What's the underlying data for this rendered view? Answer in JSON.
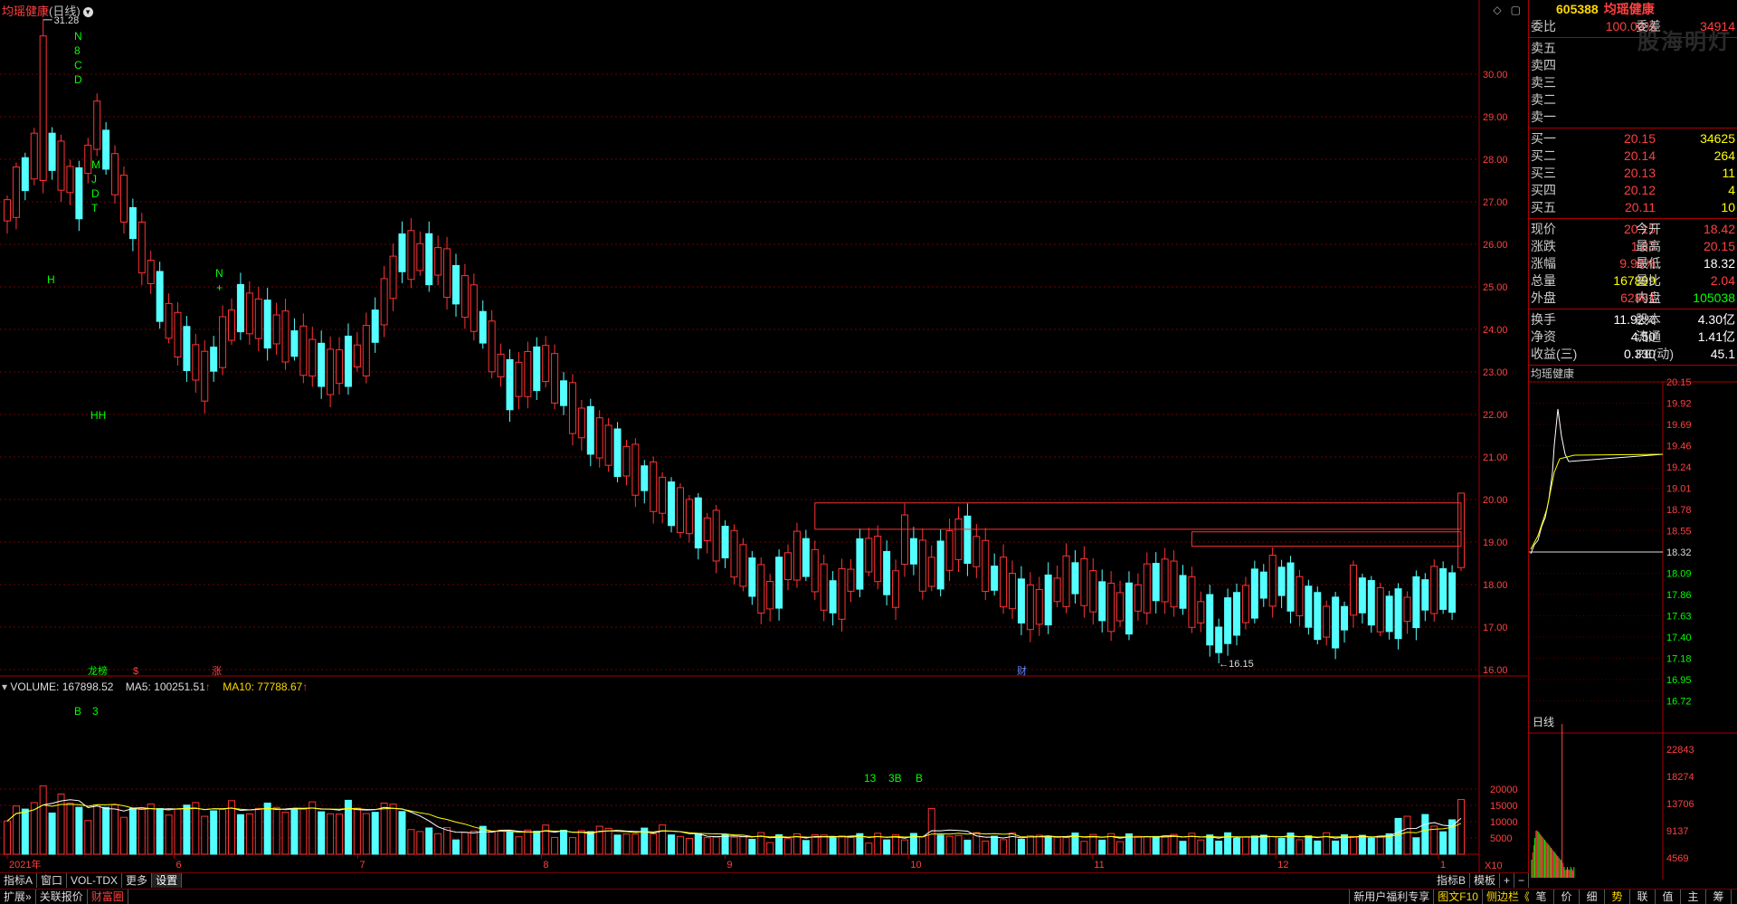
{
  "kline": {
    "name": "均瑶健康",
    "period": "(日线)",
    "high_mark": "31.28",
    "low_mark": "16.15",
    "signals": {
      "n8cd": [
        "N",
        "8",
        "C",
        "D"
      ],
      "mjdt": [
        "M",
        "J",
        "D",
        "T"
      ],
      "h": "H",
      "hh": "HH",
      "n": "N",
      "plus": "+"
    },
    "event_tags": {
      "longhu": "龙榜",
      "dollar": "$",
      "zhang": "涨",
      "cai": "财"
    },
    "price_axis": [
      "30.00",
      "29.00",
      "28.00",
      "27.00",
      "26.00",
      "25.00",
      "24.00",
      "23.00",
      "22.00",
      "21.00",
      "20.00",
      "19.00",
      "18.00",
      "17.00",
      "16.00"
    ],
    "colors": {
      "up": "#ff3232",
      "down": "#54ffff",
      "grid": "#700000",
      "ma5": "#ffffff",
      "ma10": "#ffff00",
      "box": "#ff3232"
    }
  },
  "volume": {
    "title": "VOLUME: 167898.52",
    "ma5": "MA5: 100251.51",
    "ma10": "MA10: 77788.67",
    "axis": [
      "20000",
      "15000",
      "10000",
      "5000"
    ],
    "x10": "X10",
    "signals": {
      "b3": "3",
      "b": "B",
      "s13": "13",
      "s3b": "3B",
      "sb": "B"
    }
  },
  "time_axis": [
    "2021年",
    "6",
    "7",
    "8",
    "9",
    "10",
    "11",
    "12",
    "1"
  ],
  "right": {
    "code": "605388",
    "name": "均瑶健康",
    "watermark": "股海明灯",
    "weibi_label": "委比",
    "weibi_pct": "100.00%",
    "weicha_label": "委差",
    "weicha_val": "34914",
    "sells": [
      {
        "label": "卖五",
        "price": "",
        "vol": ""
      },
      {
        "label": "卖四",
        "price": "",
        "vol": ""
      },
      {
        "label": "卖三",
        "price": "",
        "vol": ""
      },
      {
        "label": "卖二",
        "price": "",
        "vol": ""
      },
      {
        "label": "卖一",
        "price": "",
        "vol": ""
      }
    ],
    "buys": [
      {
        "label": "买一",
        "price": "20.15",
        "vol": "34625"
      },
      {
        "label": "买二",
        "price": "20.14",
        "vol": "264"
      },
      {
        "label": "买三",
        "price": "20.13",
        "vol": "11"
      },
      {
        "label": "买四",
        "price": "20.12",
        "vol": "4"
      },
      {
        "label": "买五",
        "price": "20.11",
        "vol": "10"
      }
    ],
    "quote": [
      {
        "l1": "现价",
        "v1": "20.15",
        "l2": "今开",
        "v2": "18.42"
      },
      {
        "l1": "涨跌",
        "v1": "1.83",
        "l2": "最高",
        "v2": "20.15"
      },
      {
        "l1": "涨幅",
        "v1": "9.99%",
        "l2": "最低",
        "v2": "18.32"
      },
      {
        "l1": "总量",
        "v1": "167899",
        "l2": "量比",
        "v2": "2.04"
      },
      {
        "l1": "外盘",
        "v1": "62861",
        "l2": "内盘",
        "v2": "105038"
      }
    ],
    "fund": [
      {
        "l1": "换手",
        "v1": "11.92%",
        "l2": "股本",
        "v2": "4.30亿"
      },
      {
        "l1": "净资",
        "v1": "4.50",
        "l2": "流通",
        "v2": "1.41亿"
      },
      {
        "l1": "收益(三)",
        "v1": "0.330",
        "l2": "PE(动)",
        "v2": "45.1"
      }
    ],
    "intraday_title": "均瑶健康",
    "intraday_axis": [
      "20.15",
      "19.92",
      "19.69",
      "19.46",
      "19.24",
      "19.01",
      "18.78",
      "18.55",
      "18.32",
      "18.09",
      "17.86",
      "17.63",
      "17.40",
      "17.18",
      "16.95",
      "16.72"
    ],
    "intraday_vol_axis": [
      "22843",
      "18274",
      "13706",
      "9137",
      "4569"
    ],
    "daily_btn": "日线",
    "tabs": [
      "笔",
      "价",
      "细",
      "势",
      "联",
      "值",
      "主",
      "筹"
    ]
  },
  "bottom1": {
    "tabs": [
      "指标A",
      "窗口",
      "VOL-TDX",
      "更多",
      "设置"
    ],
    "right": [
      "指标B",
      "模板",
      "+",
      "−"
    ]
  },
  "bottom2": {
    "tabs": [
      "扩展»",
      "关联报价",
      "财富圈"
    ],
    "promo": [
      "新用户福利专享",
      "图文F10",
      "侧边栏《"
    ]
  }
}
